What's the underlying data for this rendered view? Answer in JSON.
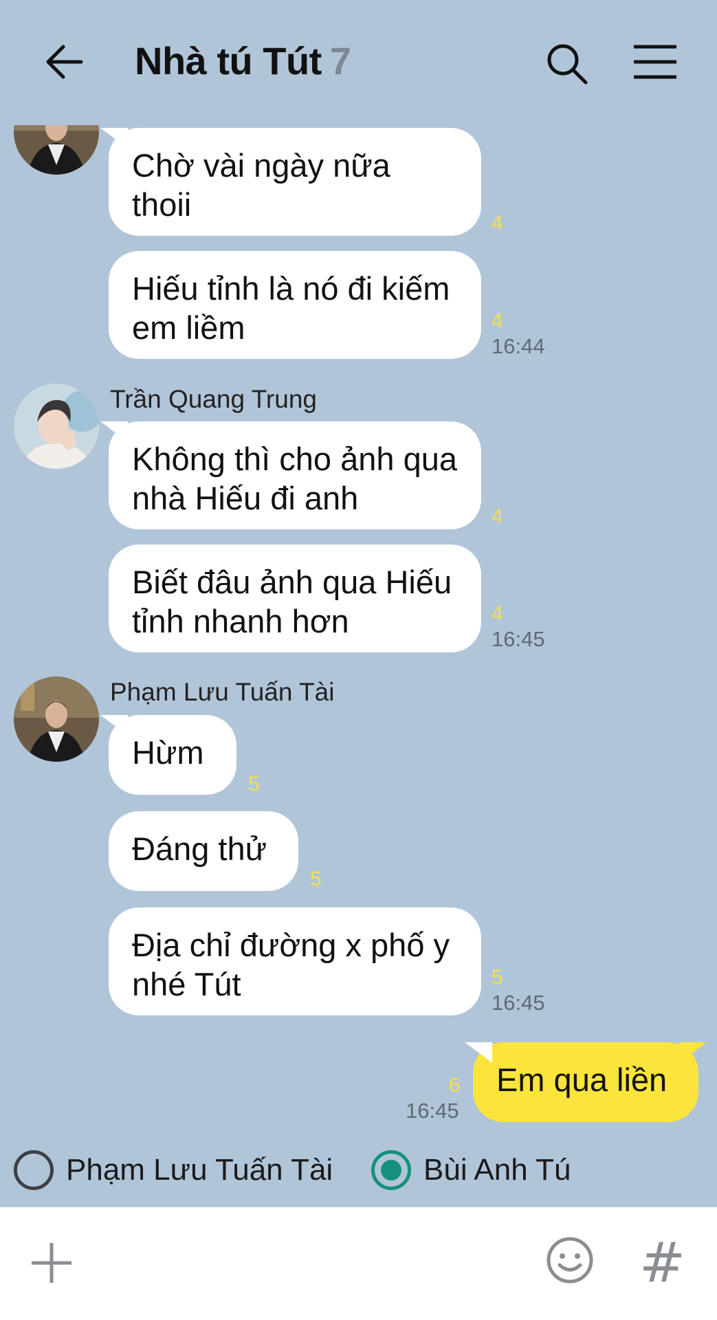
{
  "header": {
    "title": "Nhà tú Tút",
    "member_count": "7"
  },
  "messages": {
    "m1": {
      "text": "Chờ vài ngày nữa thoii",
      "unread": "4"
    },
    "m2": {
      "text": "Hiếu tỉnh là nó đi kiếm em liềm",
      "unread": "4",
      "time": "16:44"
    },
    "m3": {
      "sender": "Trần Quang Trung",
      "text": "Không thì cho ảnh qua nhà Hiếu đi anh",
      "unread": "4"
    },
    "m4": {
      "text": "Biết đâu ảnh qua Hiếu tỉnh nhanh hơn",
      "unread": "4",
      "time": "16:45"
    },
    "m5": {
      "sender": "Phạm Lưu Tuấn Tài",
      "text": "Hừm",
      "unread": "5"
    },
    "m6": {
      "text": "Đáng thử",
      "unread": "5"
    },
    "m7": {
      "text": "Địa chỉ đường x phố y nhé Tút",
      "unread": "5",
      "time": "16:45"
    },
    "m8": {
      "text": "Em qua liền",
      "unread": "6",
      "time": "16:45"
    }
  },
  "poll": {
    "option1": {
      "label": "Phạm Lưu Tuấn Tài",
      "selected": false
    },
    "option2": {
      "label": "Bùi Anh Tú",
      "selected": true
    }
  },
  "icons": {
    "back": "arrow-left-icon",
    "search": "search-icon",
    "menu": "hamburger-menu-icon",
    "plus": "plus-icon",
    "emoji": "emoji-icon",
    "hashtag": "hashtag-icon"
  },
  "input_bar": {
    "hashtag_glyph": "#"
  },
  "colors": {
    "background": "#b1c5d9",
    "my_bubble": "#fbe43b",
    "unread": "#f3e14a",
    "radio_selected": "#14907c"
  }
}
